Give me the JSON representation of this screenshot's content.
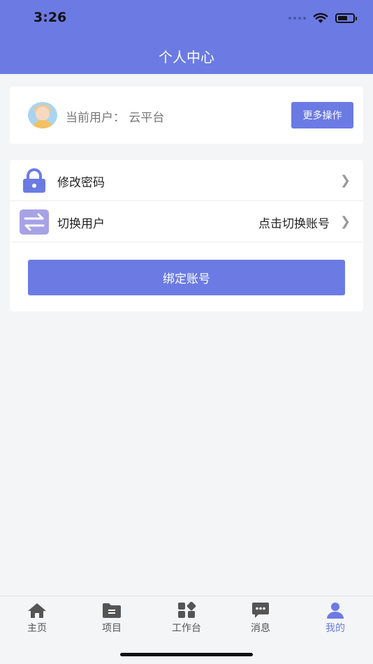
{
  "status_bar": {
    "time": "3:26"
  },
  "header": {
    "title": "个人中心"
  },
  "user_card": {
    "current_user": "当前用户： 云平台",
    "more_button": "更多操作"
  },
  "menu": [
    {
      "label": "修改密码",
      "value": "",
      "icon": "lock-icon"
    },
    {
      "label": "切换用户",
      "value": "点击切换账号",
      "icon": "swap-icon"
    }
  ],
  "bind_button": "绑定账号",
  "tabbar": [
    {
      "label": "主页",
      "icon": "home-icon"
    },
    {
      "label": "项目",
      "icon": "folder-icon"
    },
    {
      "label": "工作台",
      "icon": "workbench-icon"
    },
    {
      "label": "消息",
      "icon": "message-icon"
    },
    {
      "label": "我的",
      "icon": "user-icon",
      "active": true
    }
  ],
  "colors": {
    "accent": "#6b7be3",
    "background": "#f4f5f6"
  }
}
